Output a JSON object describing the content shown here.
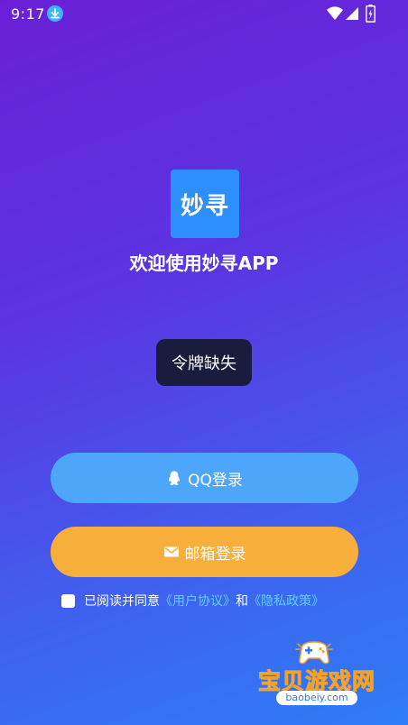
{
  "status_bar": {
    "time": "9:17",
    "icons": [
      "download-icon",
      "wifi-icon",
      "signal-icon",
      "battery-icon"
    ]
  },
  "logo": {
    "text": "妙寻"
  },
  "welcome": {
    "title": "欢迎使用妙寻APP"
  },
  "toast": {
    "message": "令牌缺失"
  },
  "buttons": {
    "qq_label": "QQ登录",
    "email_label": "邮箱登录"
  },
  "agreement": {
    "prefix": "已阅读并同意",
    "user_agreement": "《用户协议》",
    "and": "和",
    "privacy_policy": "《隐私政策》"
  },
  "watermark": {
    "title": "宝贝游戏网",
    "url": "baobeiy.com"
  },
  "colors": {
    "background_top": "#6a1fd6",
    "background_bottom": "#2f7cf6",
    "logo_bg": "#2d8ffb",
    "toast_bg": "#191c3c",
    "qq_button": "#4ea6fb",
    "email_button": "#f8ae3b",
    "link": "#5fd0ff"
  }
}
